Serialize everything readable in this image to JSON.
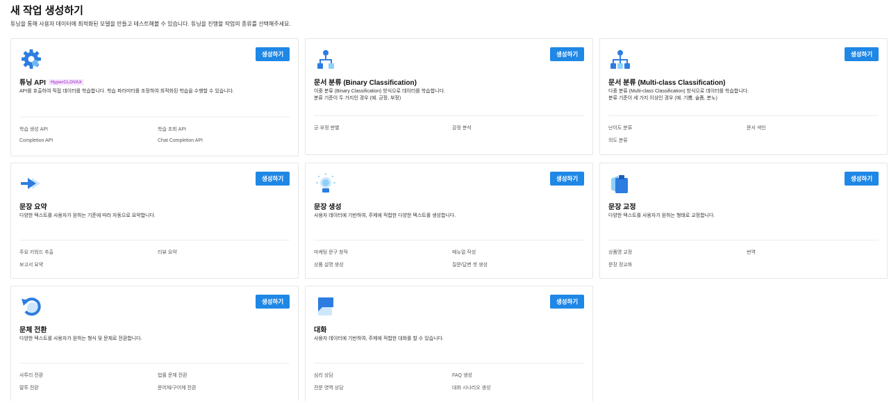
{
  "page": {
    "title": "새 작업 생성하기",
    "description": "튜닝을 통해 사용자 데이터에 최적화된 모델을 만들고 테스트해볼 수 있습니다. 튜닝을 진행할 작업의 종류를 선택해주세요."
  },
  "colors": {
    "accent": "#1f87e5",
    "badge_text": "#b64bd6",
    "border": "#e6e6e6"
  },
  "cards": [
    {
      "icon": "gear-icon",
      "title": "튜닝 API",
      "badge": "HyperCLOVAX",
      "button": "생성하기",
      "desc1": "API를 호출하여 직접 데이터를 학습합니다. 학습 파라미터를 조정하여 최적화된 학습을 수행할 수 있습니다.",
      "desc2": "",
      "tags": [
        "학습 생성 API",
        "학습 조회 API",
        "Completion API",
        "Chat Completion API"
      ]
    },
    {
      "icon": "binary-tree-icon",
      "title": "문서 분류 (Binary Classification)",
      "button": "생성하기",
      "desc1": "이중 분류 (Binary Classification) 방식으로 데이터를 학습합니다.",
      "desc2": "분류 기준이 두 가지인 경우 (예. 긍정, 부정)",
      "tags": [
        "긍·부정 판별",
        "감정 분석"
      ]
    },
    {
      "icon": "multi-tree-icon",
      "title": "문서 분류 (Multi-class Classification)",
      "button": "생성하기",
      "desc1": "다중 분류 (Multi-class Classification) 방식으로 데이터를 학습합니다.",
      "desc2": "분류 기준이 세 가지 이상인 경우 (예. 기쁨, 슬픔, 분노)",
      "tags": [
        "난이도 분류",
        "문서 색인",
        "의도 분류"
      ]
    },
    {
      "icon": "arrow-right-icon",
      "title": "문장 요약",
      "button": "생성하기",
      "desc1": "다양한 텍스트를 사용자가 원하는 기준에 따라 자동으로 요약합니다.",
      "desc2": "",
      "tags": [
        "주요 키워드 추출",
        "리뷰 요약",
        "보고서 요약"
      ]
    },
    {
      "icon": "lightbulb-icon",
      "title": "문장 생성",
      "button": "생성하기",
      "desc1": "사용자 데이터에 기반하여, 주제에 적합한 다양한 텍스트를 생성합니다.",
      "desc2": "",
      "tags": [
        "마케팅 문구 창작",
        "매뉴얼 작성",
        "상품 설명 생성",
        "질문/답변 셋 생성"
      ]
    },
    {
      "icon": "clipboard-icon",
      "title": "문장 교정",
      "button": "생성하기",
      "desc1": "다양한 텍스트를 사용자가 원하는 형태로 교정합니다.",
      "desc2": "",
      "tags": [
        "상품명 교정",
        "번역",
        "문장 정교화"
      ]
    },
    {
      "icon": "refresh-icon",
      "title": "문체 전환",
      "button": "생성하기",
      "desc1": "다양한 텍스트를 사용자가 원하는 형식 및 문체로 전환합니다.",
      "desc2": "",
      "tags": [
        "사투리 전환",
        "법률 문체 전환",
        "말투 전환",
        "문어체/구어체 전환"
      ]
    },
    {
      "icon": "chat-icon",
      "title": "대화",
      "button": "생성하기",
      "desc1": "사용자 데이터에 기반하여, 주제에 적합한 대화를 할 수 있습니다.",
      "desc2": "",
      "tags": [
        "심리 상담",
        "FAQ 생성",
        "전문 영역 상담",
        "대화 시나리오 생성"
      ]
    }
  ]
}
